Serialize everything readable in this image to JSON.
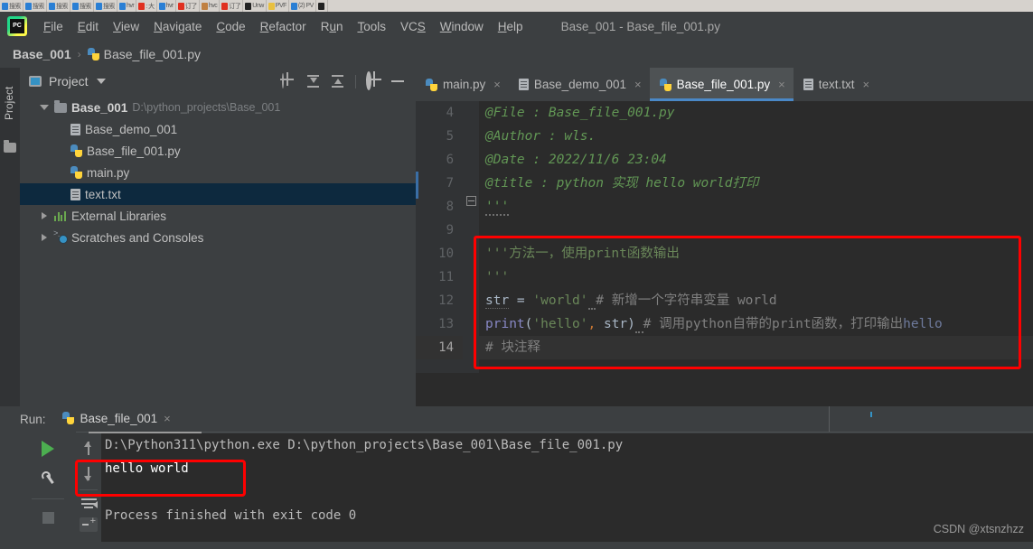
{
  "taskbar": {
    "items": [
      {
        "color": "#2a7fd4",
        "text": "搜索"
      },
      {
        "color": "#2a7fd4",
        "text": "搜索"
      },
      {
        "color": "#2a7fd4",
        "text": "搜索"
      },
      {
        "color": "#2a7fd4",
        "text": "搜索"
      },
      {
        "color": "#2a7fd4",
        "text": "搜索"
      },
      {
        "color": "#2a7fd4",
        "text": "hvr"
      },
      {
        "color": "#e03020",
        "text": ": 大"
      },
      {
        "color": "#2a7fd4",
        "text": "hvr"
      },
      {
        "color": "#e03020",
        "text": "订了"
      },
      {
        "color": "#c08040",
        "text": "hvc"
      },
      {
        "color": "#e03020",
        "text": "订了"
      },
      {
        "color": "#222222",
        "text": "Unw"
      },
      {
        "color": "#e8c040",
        "text": "PVF"
      },
      {
        "color": "#2a7fd4",
        "text": "(2) PV"
      },
      {
        "color": "#222222",
        "text": ""
      }
    ]
  },
  "menubar": {
    "logo": "pycharm-logo",
    "items": [
      {
        "pre": "",
        "key": "F",
        "post": "ile"
      },
      {
        "pre": "",
        "key": "E",
        "post": "dit"
      },
      {
        "pre": "",
        "key": "V",
        "post": "iew"
      },
      {
        "pre": "",
        "key": "N",
        "post": "avigate"
      },
      {
        "pre": "",
        "key": "C",
        "post": "ode"
      },
      {
        "pre": "",
        "key": "R",
        "post": "efactor"
      },
      {
        "pre": "R",
        "key": "u",
        "post": "n"
      },
      {
        "pre": "",
        "key": "T",
        "post": "ools"
      },
      {
        "pre": "VC",
        "key": "S",
        "post": ""
      },
      {
        "pre": "",
        "key": "W",
        "post": "indow"
      },
      {
        "pre": "",
        "key": "H",
        "post": "elp"
      }
    ],
    "window_title": "Base_001 - Base_file_001.py"
  },
  "breadcrumb": {
    "project": "Base_001",
    "separator": "›",
    "file": "Base_file_001.py"
  },
  "left_strip": {
    "project_label": "Project",
    "folder_icon": "folder-icon"
  },
  "project_panel": {
    "title": "Project",
    "tools": [
      "locate-icon",
      "expand-all-icon",
      "collapse-all-icon",
      "gear-icon",
      "minimize-icon"
    ],
    "tree": [
      {
        "indent": 0,
        "chevron": "down",
        "icon": "folder",
        "name": "Base_001",
        "bold": true,
        "path": "D:\\python_projects\\Base_001",
        "selected": false
      },
      {
        "indent": 1,
        "chevron": "none",
        "icon": "doc",
        "name": "Base_demo_001",
        "bold": false,
        "path": "",
        "selected": false
      },
      {
        "indent": 1,
        "chevron": "none",
        "icon": "py",
        "name": "Base_file_001.py",
        "bold": false,
        "path": "",
        "selected": false
      },
      {
        "indent": 1,
        "chevron": "none",
        "icon": "py",
        "name": "main.py",
        "bold": false,
        "path": "",
        "selected": false
      },
      {
        "indent": 1,
        "chevron": "none",
        "icon": "doc",
        "name": "text.txt",
        "bold": false,
        "path": "",
        "selected": true
      },
      {
        "indent": 0,
        "chevron": "right",
        "icon": "lib",
        "name": "External Libraries",
        "bold": false,
        "path": "",
        "selected": false
      },
      {
        "indent": 0,
        "chevron": "right",
        "icon": "scratch",
        "name": "Scratches and Consoles",
        "bold": false,
        "path": "",
        "selected": false
      }
    ]
  },
  "editor": {
    "tabs": [
      {
        "icon": "py",
        "label": "main.py",
        "active": false,
        "close": "×"
      },
      {
        "icon": "doc",
        "label": "Base_demo_001",
        "active": false,
        "close": "×"
      },
      {
        "icon": "py",
        "label": "Base_file_001.py",
        "active": true,
        "close": "×"
      },
      {
        "icon": "doc",
        "label": "text.txt",
        "active": false,
        "close": "×"
      }
    ],
    "lines": [
      {
        "num": "4",
        "current": false,
        "tokens": [
          {
            "t": "@File    : Base_file_001.py",
            "c": "kw-doc"
          }
        ]
      },
      {
        "num": "5",
        "current": false,
        "tokens": [
          {
            "t": "@Author  : wls.",
            "c": "kw-doc"
          }
        ]
      },
      {
        "num": "6",
        "current": false,
        "tokens": [
          {
            "t": "@Date    : 2022/11/6 23:04",
            "c": "kw-doc"
          }
        ]
      },
      {
        "num": "7",
        "current": false,
        "tokens": [
          {
            "t": "@title   : python 实现 hello world打印",
            "c": "kw-doc"
          }
        ]
      },
      {
        "num": "8",
        "current": false,
        "tokens": [
          {
            "t": "'''",
            "c": "kw-doc wavy"
          }
        ]
      },
      {
        "num": "9",
        "current": false,
        "tokens": [
          {
            "t": "",
            "c": "kw-doc"
          }
        ]
      },
      {
        "num": "10",
        "current": false,
        "tokens": [
          {
            "t": "'''方法一，使用print函数输出",
            "c": "kw-str"
          }
        ]
      },
      {
        "num": "11",
        "current": false,
        "tokens": [
          {
            "t": "'''",
            "c": "kw-str"
          }
        ]
      },
      {
        "num": "12",
        "current": false,
        "tokens": [
          {
            "t": "str",
            "c": "kw-var"
          },
          {
            "t": " = ",
            "c": "kw-punct"
          },
          {
            "t": "'world'",
            "c": "kw-str"
          },
          {
            "t": " ",
            "c": "wavy"
          },
          {
            "t": "# 新增一个字符串变量 world",
            "c": "kw-cmt"
          }
        ]
      },
      {
        "num": "13",
        "current": false,
        "tokens": [
          {
            "t": "print",
            "c": "kw-fn"
          },
          {
            "t": "(",
            "c": "kw-punct"
          },
          {
            "t": "'hello'",
            "c": "kw-str"
          },
          {
            "t": ",",
            "c": "kw-orange"
          },
          {
            "t": " str",
            "c": "kw-punct"
          },
          {
            "t": ")",
            "c": "kw-punct"
          },
          {
            "t": " ",
            "c": "wavy"
          },
          {
            "t": "# 调用python自带的print函数，打印输出",
            "c": "kw-cmt"
          },
          {
            "t": "hello",
            "c": "kw-hello"
          }
        ]
      },
      {
        "num": "14",
        "current": true,
        "tokens": [
          {
            "t": "# 块注释",
            "c": "kw-cmt"
          }
        ]
      }
    ]
  },
  "run_panel": {
    "label": "Run:",
    "tab_label": "Base_file_001",
    "tab_close": "×",
    "tools_left": [
      "run-icon",
      "wrench-icon",
      "stop-icon"
    ],
    "tools_right": [
      "scroll-up-icon",
      "scroll-down-icon",
      "soft-wrap-icon",
      "print-icon"
    ],
    "console": [
      {
        "text": "D:\\Python311\\python.exe D:\\python_projects\\Base_001\\Base_file_001.py",
        "style": "cl-path"
      },
      {
        "text": "hello world",
        "style": "cl-out"
      },
      {
        "text": "",
        "style": "cl-fin"
      },
      {
        "text": "Process finished with exit code 0",
        "style": "cl-fin"
      }
    ]
  },
  "annotations": {
    "code_highlight_color": "#fe0000",
    "output_highlight_color": "#fe0000"
  },
  "watermark": "CSDN @xtsnzhzz"
}
